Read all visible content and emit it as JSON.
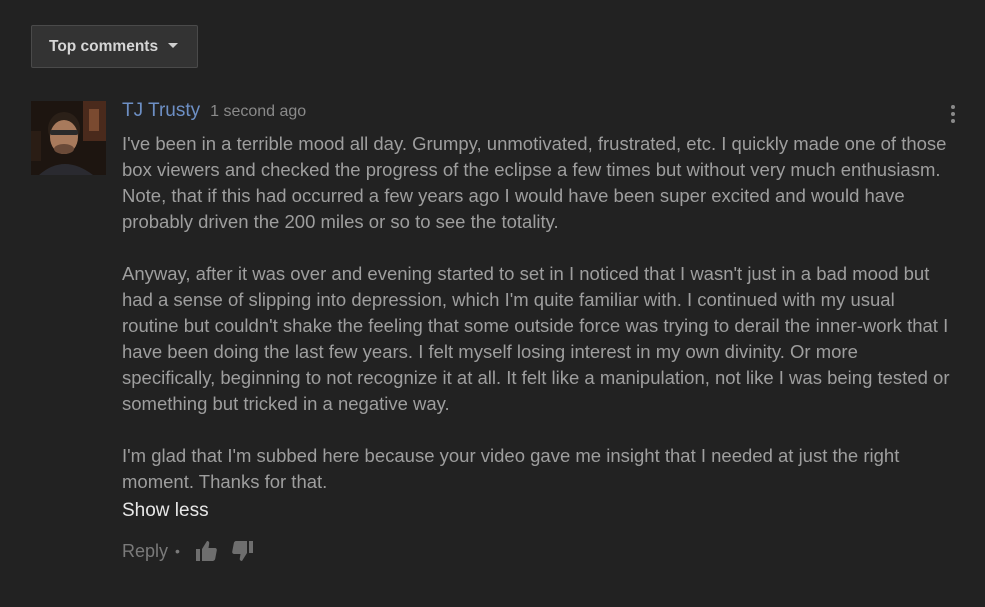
{
  "sort": {
    "label": "Top comments",
    "caret_icon": "dropdown-caret-icon"
  },
  "comment": {
    "author": "TJ Trusty",
    "timestamp": "1 second ago",
    "avatar_icon": "user-avatar",
    "paragraphs": [
      "I've been in a terrible mood all day. Grumpy, unmotivated, frustrated, etc. I quickly made one of those box viewers and checked the progress of the eclipse a few times but without very much enthusiasm. Note, that if this had occurred a few years ago I would have been super excited and would have probably driven the 200 miles or so to see the totality.",
      "Anyway, after it was over and evening started to set in I noticed that I wasn't just in a bad mood but had a sense of slipping into depression, which I'm quite familiar with. I continued with my usual routine but couldn't shake the feeling that some outside force was trying to derail the inner-work that I have been doing the last few years. I felt myself losing interest in my own divinity. Or more specifically, beginning to not recognize it at all. It felt like a manipulation, not like I was being tested or something but tricked in a negative way.",
      "I'm glad that I'm subbed here because your video gave me insight that I needed at just the right moment. Thanks for that."
    ],
    "show_less": "Show less",
    "actions": {
      "reply": "Reply",
      "separator": "•",
      "like_icon": "thumbs-up-icon",
      "dislike_icon": "thumbs-down-icon"
    },
    "menu_icon": "more-vertical-icon"
  },
  "colors": {
    "background": "#222222",
    "author": "#6d8fc4",
    "body_text": "#9e9e9e",
    "muted": "#7a7a7a"
  }
}
